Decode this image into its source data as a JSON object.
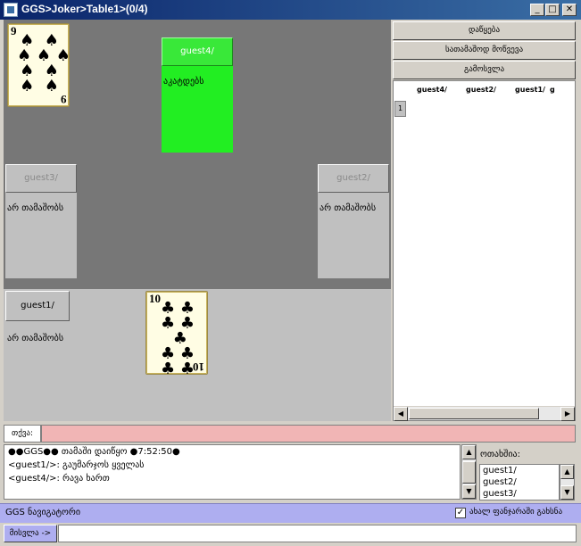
{
  "window": {
    "title": "GGS>Joker>Table1>(0/4)",
    "min": "_",
    "max": "□",
    "close": "✕"
  },
  "table": {
    "top_card": {
      "rank": "9",
      "suit": "♠",
      "color": "#000000"
    },
    "bottom_card": {
      "rank": "10",
      "suit": "♣",
      "color": "#000000"
    },
    "seats": {
      "top": {
        "name": "guest4/",
        "status": "აკატდებს"
      },
      "left": {
        "name": "guest3/",
        "status": "არ თამაშობს"
      },
      "right": {
        "name": "guest2/",
        "status": "არ თამაშობს"
      },
      "bottom": {
        "name": "guest1/",
        "status": "არ თამაშობს"
      }
    },
    "active_seat_color": "#22ee22"
  },
  "sidebar": {
    "buttons": [
      "დაწყება",
      "სათამაშოდ მოწვევა",
      "გამოსვლა"
    ],
    "score_headers": [
      "guest4/",
      "guest2/",
      "guest1/",
      "g"
    ],
    "row_number": "1"
  },
  "input": {
    "label": "თქვა:",
    "value": ""
  },
  "chat": {
    "lines": [
      "●●GGS●● თამაში დაიწყო ●7:52:50●",
      "<guest1/>: გაუმარჯოს ყველას",
      "<guest4/>: რავა ხართ"
    ]
  },
  "players_panel": {
    "label": "ოთახშია:",
    "players": [
      "guest1/",
      "guest2/",
      "guest3/"
    ]
  },
  "statusbar": {
    "nav_label": "GGS ნავიგატორი",
    "checkbox_label": "ახალ ფანჯარაში გახსნა",
    "checked": true
  },
  "bottombar": {
    "go_label": "მისვლა ->",
    "go_value": ""
  }
}
